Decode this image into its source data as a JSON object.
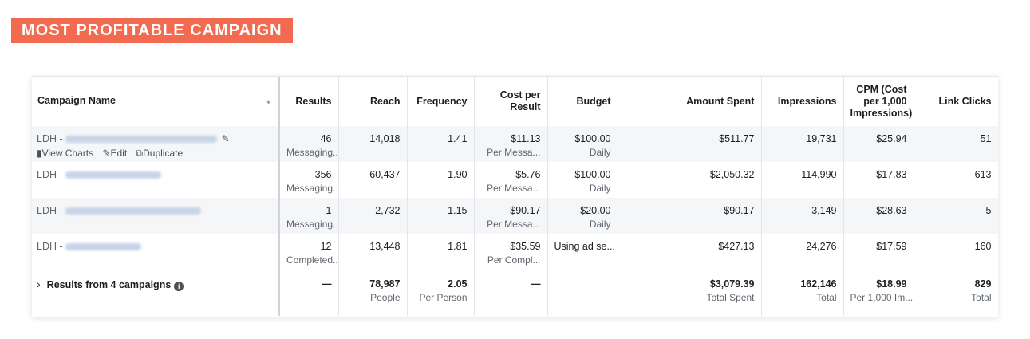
{
  "banner": {
    "title": "MOST PROFITABLE CAMPAIGN"
  },
  "columns": {
    "campaign_name": "Campaign Name",
    "results": "Results",
    "reach": "Reach",
    "frequency": "Frequency",
    "cost_per_result": "Cost per Result",
    "budget": "Budget",
    "amount_spent": "Amount Spent",
    "impressions": "Impressions",
    "cpm": "CPM (Cost per 1,000 Impressions)",
    "link_clicks": "Link Clicks"
  },
  "row_actions": {
    "view_charts": "View Charts",
    "edit": "Edit",
    "duplicate": "Duplicate"
  },
  "rows": [
    {
      "name_prefix": "LDH -",
      "results": "46",
      "results_sub": "Messaging...",
      "reach": "14,018",
      "frequency": "1.41",
      "cost": "$11.13",
      "cost_sub": "Per Messa...",
      "budget": "$100.00",
      "budget_sub": "Daily",
      "spent": "$511.77",
      "impressions": "19,731",
      "cpm": "$25.94",
      "clicks": "51"
    },
    {
      "name_prefix": "LDH -",
      "results": "356",
      "results_sub": "Messaging...",
      "reach": "60,437",
      "frequency": "1.90",
      "cost": "$5.76",
      "cost_sub": "Per Messa...",
      "budget": "$100.00",
      "budget_sub": "Daily",
      "spent": "$2,050.32",
      "impressions": "114,990",
      "cpm": "$17.83",
      "clicks": "613"
    },
    {
      "name_prefix": "LDH -",
      "results": "1",
      "results_sub": "Messaging...",
      "reach": "2,732",
      "frequency": "1.15",
      "cost": "$90.17",
      "cost_sub": "Per Messa...",
      "budget": "$20.00",
      "budget_sub": "Daily",
      "spent": "$90.17",
      "impressions": "3,149",
      "cpm": "$28.63",
      "clicks": "5"
    },
    {
      "name_prefix": "LDH -",
      "results": "12",
      "results_sub": "Completed...",
      "reach": "13,448",
      "frequency": "1.81",
      "cost": "$35.59",
      "cost_sub": "Per Compl...",
      "budget": "Using ad se...",
      "budget_sub": "",
      "spent": "$427.13",
      "impressions": "24,276",
      "cpm": "$17.59",
      "clicks": "160"
    }
  ],
  "totals": {
    "label": "Results from 4 campaigns",
    "results": "—",
    "reach": "78,987",
    "reach_sub": "People",
    "frequency": "2.05",
    "frequency_sub": "Per Person",
    "cost": "—",
    "spent": "$3,079.39",
    "spent_sub": "Total Spent",
    "impressions": "162,146",
    "impressions_sub": "Total",
    "cpm": "$18.99",
    "cpm_sub": "Per 1,000 Im...",
    "clicks": "829",
    "clicks_sub": "Total"
  }
}
